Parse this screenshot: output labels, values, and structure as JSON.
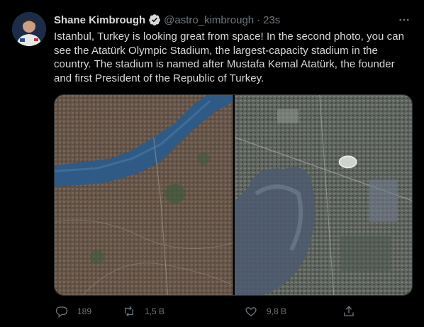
{
  "tweet": {
    "author_name": "Shane Kimbrough",
    "handle": "@astro_kimbrough",
    "separator": "·",
    "time": "23s",
    "text": "Istanbul, Turkey is looking great from space! In the second photo, you can\nsee the Atatürk Olympic Stadium, the largest-capacity stadium in the\ncountry. The stadium is named after Mustafa Kemal Atatürk, the founder\nand first President of the Republic of Turkey.",
    "verified": true,
    "avatar_icon": "astronaut-avatar",
    "more_icon": "more-options-icon"
  },
  "media": {
    "photo_count": 2,
    "photos": [
      {
        "subject": "satellite-view-bosphorus"
      },
      {
        "subject": "satellite-view-stadium"
      }
    ]
  },
  "actions": {
    "reply_count": "189",
    "retweet_count": "1,5 B",
    "like_count": "9,8 B",
    "icons": [
      "reply-icon",
      "retweet-icon",
      "like-icon",
      "share-icon"
    ]
  },
  "colors": {
    "background": "#000000",
    "text": "#d9d9d9",
    "muted": "#6e767d",
    "verified_badge": "#d9d9d9",
    "water": "#2f5a86"
  }
}
